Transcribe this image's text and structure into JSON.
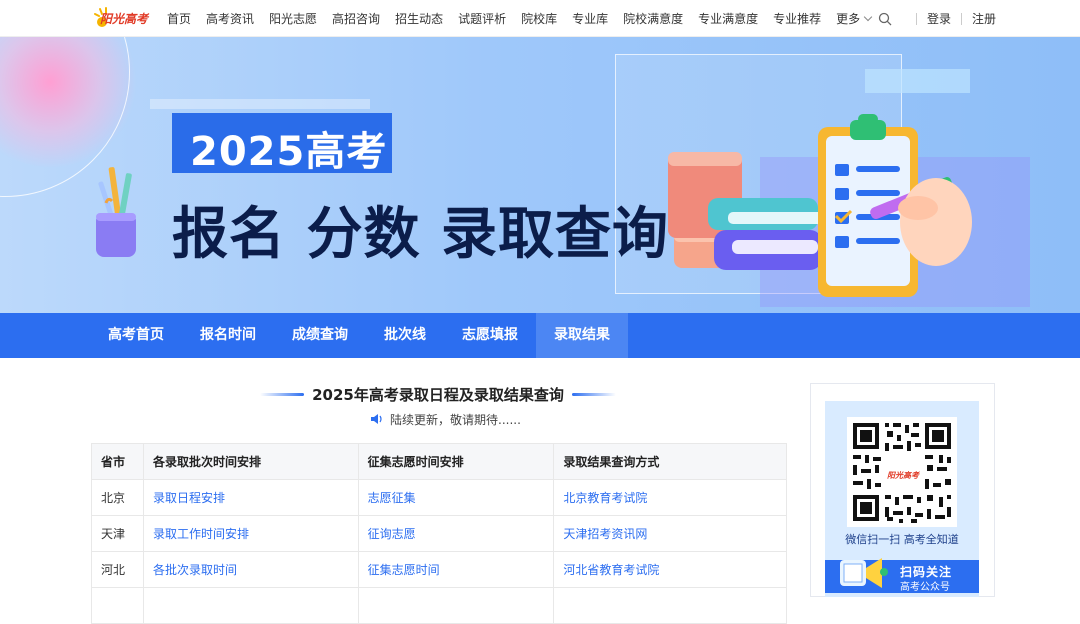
{
  "topnav": {
    "logo_text": "阳光高考",
    "items": [
      "首页",
      "高考资讯",
      "阳光志愿",
      "高招咨询",
      "招生动态",
      "试题评析",
      "院校库",
      "专业库",
      "院校满意度",
      "专业满意度",
      "专业推荐",
      "更多"
    ],
    "login": "登录",
    "register": "注册"
  },
  "banner": {
    "year_text": "2025高考",
    "headline": "报名 分数 录取查询"
  },
  "tabs": [
    "高考首页",
    "报名时间",
    "成绩查询",
    "批次线",
    "志愿填报",
    "录取结果"
  ],
  "active_tab_index": 5,
  "main": {
    "title": "2025年高考录取日程及录取结果查询",
    "notice": "陆续更新，敬请期待......"
  },
  "table": {
    "headers": [
      "省市",
      "各录取批次时间安排",
      "征集志愿时间安排",
      "录取结果查询方式"
    ],
    "rows": [
      [
        "北京",
        "录取日程安排",
        "志愿征集",
        "北京教育考试院"
      ],
      [
        "天津",
        "录取工作时间安排",
        "征询志愿",
        "天津招考资讯网"
      ],
      [
        "河北",
        "各批次录取时间",
        "征集志愿时间",
        "河北省教育考试院"
      ]
    ]
  },
  "side": {
    "qr_caption": "微信扫一扫  高考全知道",
    "follow_title": "扫码关注",
    "follow_sub": "高考公众号",
    "qr_logo": "阳光高考"
  },
  "colors": {
    "accent": "#2c6ef0",
    "tab_active": "#4c86f3",
    "headline": "#0b1d4a",
    "brand": "#e13b27"
  }
}
